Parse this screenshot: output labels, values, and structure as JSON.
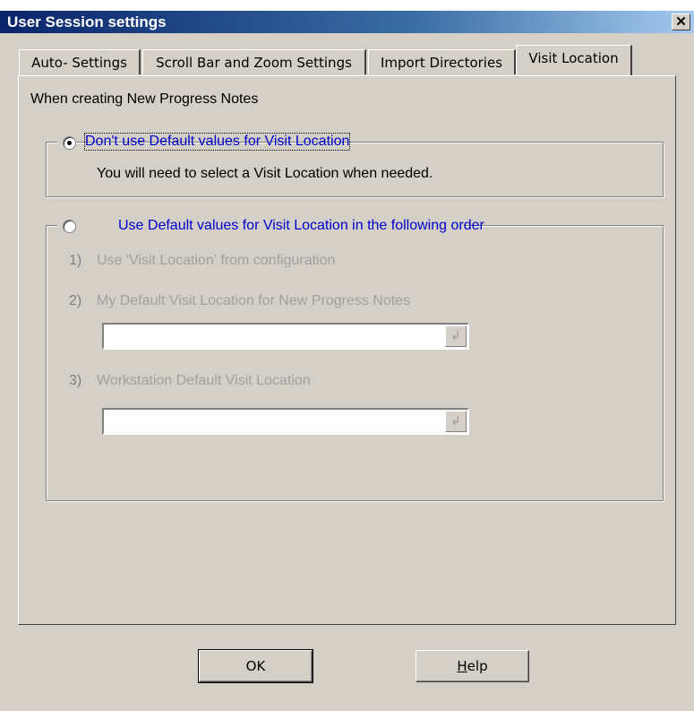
{
  "window": {
    "title": "User Session settings",
    "close_glyph": "✕"
  },
  "tabs": [
    {
      "label": "Auto- Settings"
    },
    {
      "label": "Scroll Bar and Zoom Settings"
    },
    {
      "label": "Import Directories"
    },
    {
      "label": "Visit Location"
    }
  ],
  "section_heading": "When creating New Progress Notes",
  "option1": {
    "label": "Don't use Default values for Visit Location",
    "selected": true,
    "description": "You will need to select a Visit Location when needed."
  },
  "option2": {
    "label": "Use Default values for Visit Location in the following order",
    "selected": false,
    "items": [
      {
        "num": "1)",
        "text": "Use 'Visit Location' from configuration"
      },
      {
        "num": "2)",
        "text": "My Default Visit Location  for New Progress Notes"
      },
      {
        "num": "3)",
        "text": "Workstation Default Visit Location"
      }
    ],
    "combo1_value": "",
    "combo2_value": ""
  },
  "buttons": {
    "ok": "OK",
    "help": "Help"
  },
  "colors": {
    "face": "#d4d0c8",
    "title_start": "#0a246a",
    "link_blue": "#0000cc",
    "disabled": "#a0a0a0"
  }
}
